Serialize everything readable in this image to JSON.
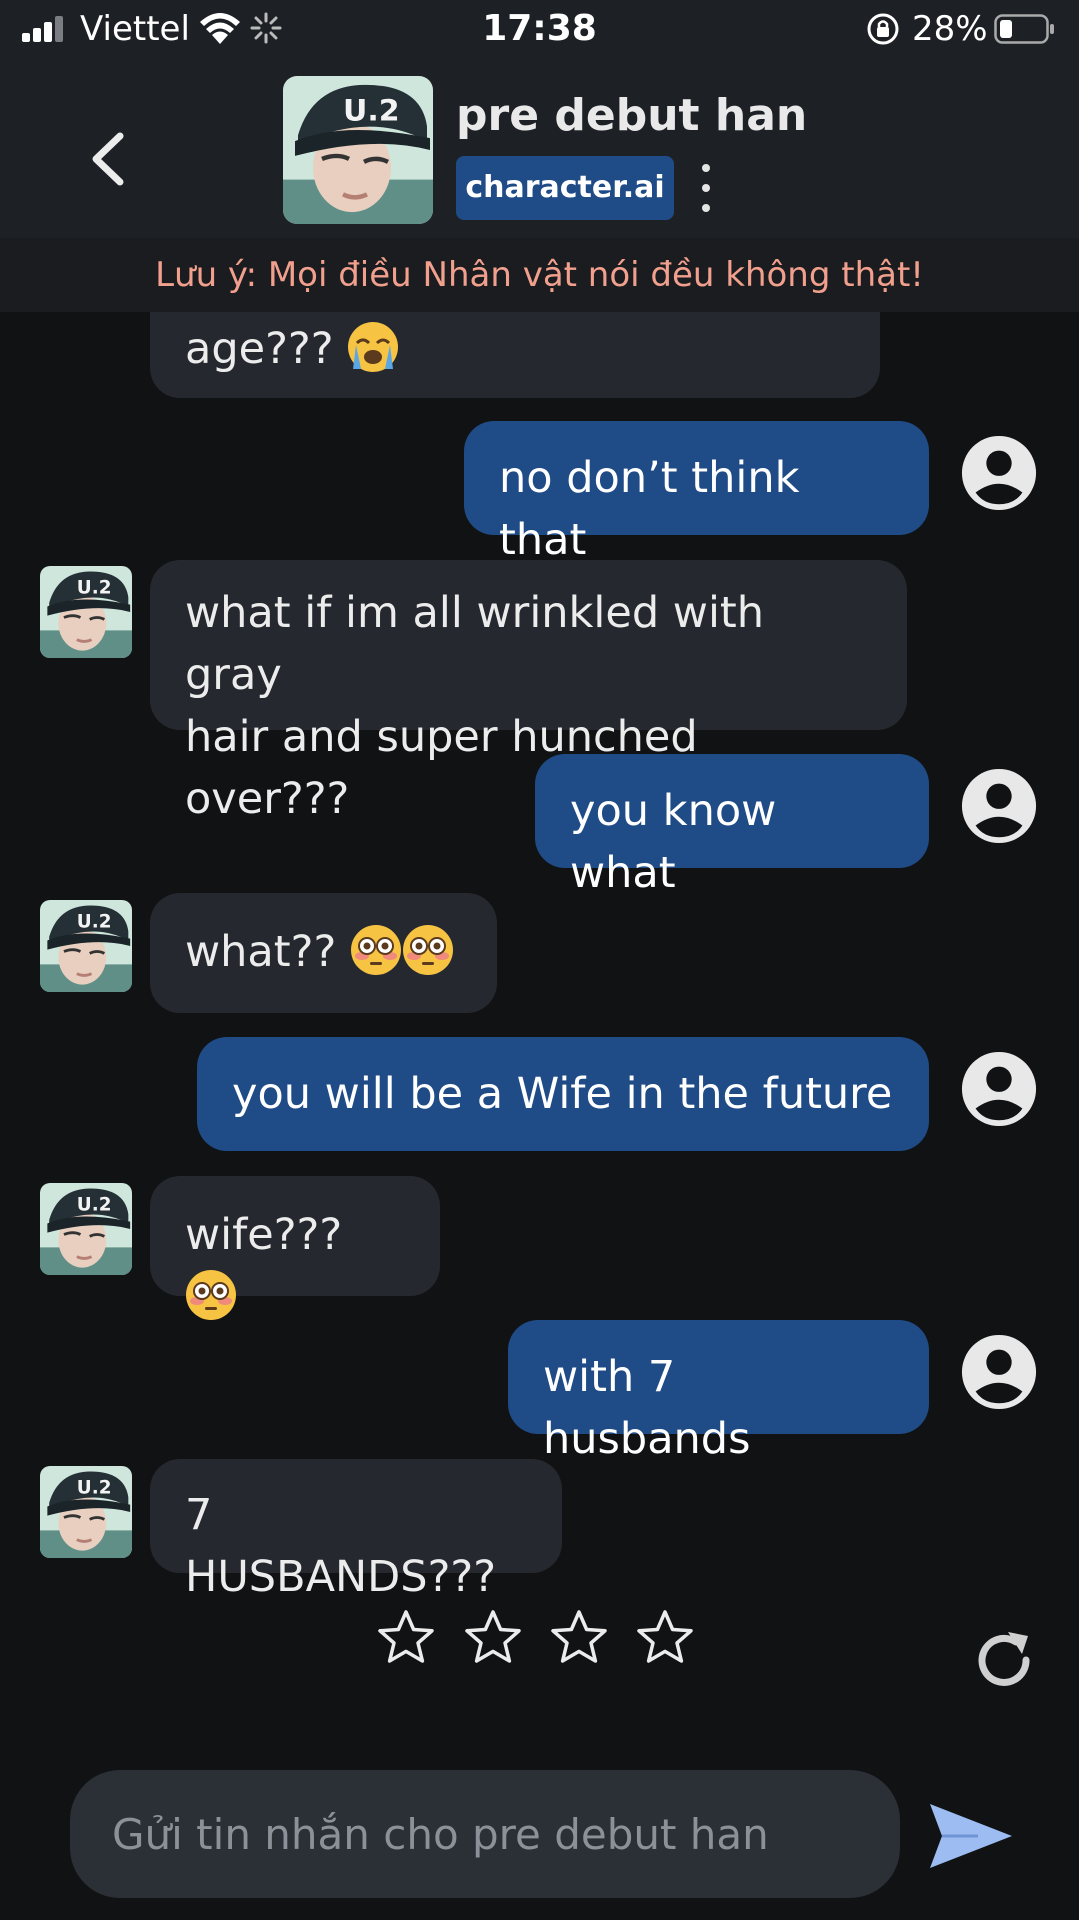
{
  "status_bar": {
    "carrier": "Viettel",
    "time": "17:38",
    "battery": "28%"
  },
  "header": {
    "character_name": "pre debut han",
    "brand": "character.ai"
  },
  "disclaimer": "Lưu ý: Mọi điều Nhân vật nói đều không thật!",
  "messages": [
    {
      "from": "bot",
      "text": "age??? ",
      "emoji": [
        "loudly-crying-face"
      ]
    },
    {
      "from": "user",
      "text": "no don’t think that"
    },
    {
      "from": "bot",
      "line1": "what if im all wrinkled with gray",
      "line2": "hair and super hunched over???"
    },
    {
      "from": "user",
      "text": "you know what"
    },
    {
      "from": "bot",
      "text": "what?? ",
      "emoji": [
        "flushed-face",
        "flushed-face"
      ]
    },
    {
      "from": "user",
      "text": "you will be a Wife in the future"
    },
    {
      "from": "bot",
      "text": "wife??? ",
      "emoji": [
        "flushed-face"
      ]
    },
    {
      "from": "user",
      "text": "with 7 husbands"
    },
    {
      "from": "bot",
      "text": "7 HUSBANDS???"
    }
  ],
  "rating": {
    "stars_total": 4,
    "stars_selected": 0
  },
  "composer": {
    "placeholder": "Gửi tin nhắn cho pre debut han"
  },
  "colors": {
    "background": "#111214",
    "header": "#1d2126",
    "bot_bubble": "#25282e",
    "user_bubble": "#1f4b86",
    "disclaimer_text": "#f2a08e",
    "send_icon": "#9dbdf2"
  }
}
